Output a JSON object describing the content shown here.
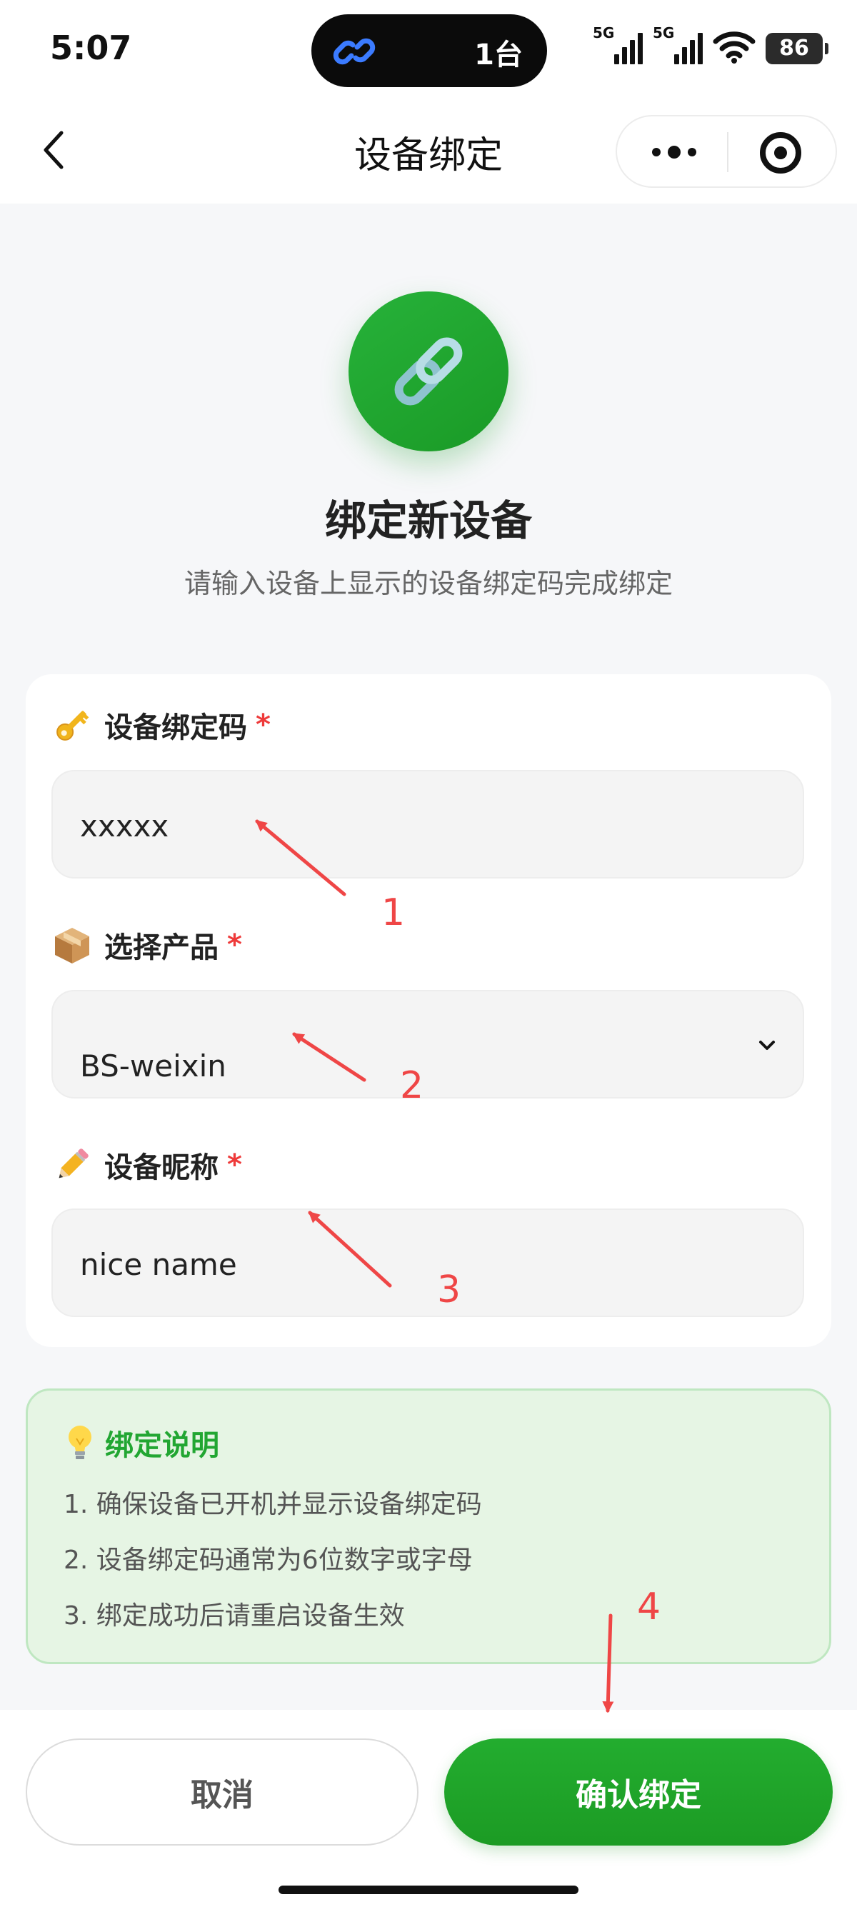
{
  "status_bar": {
    "time": "5:07",
    "island_count": "1台",
    "signal1_label": "5G",
    "signal2_label": "5G",
    "battery": "86"
  },
  "nav": {
    "title": "设备绑定"
  },
  "hero": {
    "title": "绑定新设备",
    "subtitle": "请输入设备上显示的设备绑定码完成绑定"
  },
  "form": {
    "code": {
      "label": "设备绑定码",
      "required": "*",
      "value": "xxxxx"
    },
    "product": {
      "label": "选择产品",
      "required": "*",
      "value": "BS-weixin"
    },
    "nickname": {
      "label": "设备昵称",
      "required": "*",
      "value": "nice name"
    }
  },
  "tips": {
    "title": "绑定说明",
    "items": [
      "1. 确保设备已开机并显示设备绑定码",
      "2. 设备绑定码通常为6位数字或字母",
      "3. 绑定成功后请重启设备生效"
    ]
  },
  "actions": {
    "cancel": "取消",
    "confirm": "确认绑定"
  },
  "annotations": [
    "1",
    "2",
    "3",
    "4"
  ],
  "colors": {
    "primary_green": "#1fa52c",
    "tips_bg": "#e6f5e4",
    "annotation_red": "#ef4646"
  }
}
